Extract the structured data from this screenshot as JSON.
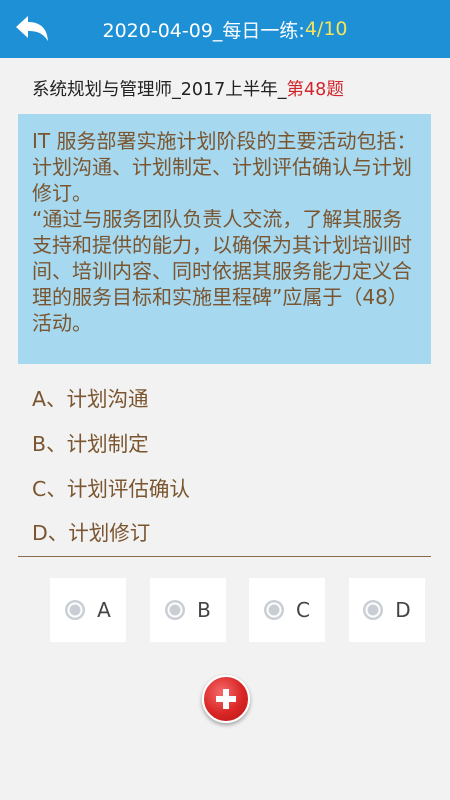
{
  "header": {
    "title_prefix": "2020-04-09_每日一练:",
    "progress": "4/10",
    "back_icon": "back-arrow-icon"
  },
  "question": {
    "source_prefix": "系统规划与管理师_2017上半年_",
    "number_label": "第48题",
    "text_lines": [
      "IT 服务部署实施计划阶段的主要活动包括：计划沟通、计划制定、计划评估确认与计划修订。",
      "“通过与服务团队负责人交流，了解其服务支持和提供的能力，以确保为其计划培训时间、培训内容、同时依据其服务能力定义合理的服务目标和实施里程碑”应属于（48）活动。"
    ]
  },
  "options": [
    {
      "label": "A、计划沟通"
    },
    {
      "label": "B、计划制定"
    },
    {
      "label": "C、计划评估确认"
    },
    {
      "label": "D、计划修订"
    }
  ],
  "answers": [
    {
      "letter": "A"
    },
    {
      "letter": "B"
    },
    {
      "letter": "C"
    },
    {
      "letter": "D"
    }
  ],
  "colors": {
    "header_bg": "#1e90d6",
    "progress_text": "#f5e35c",
    "question_bg": "#a6d9ef",
    "option_text": "#7a5530",
    "question_number": "#d0252b",
    "add_button": "#d92525"
  },
  "add_button_icon": "plus-icon"
}
